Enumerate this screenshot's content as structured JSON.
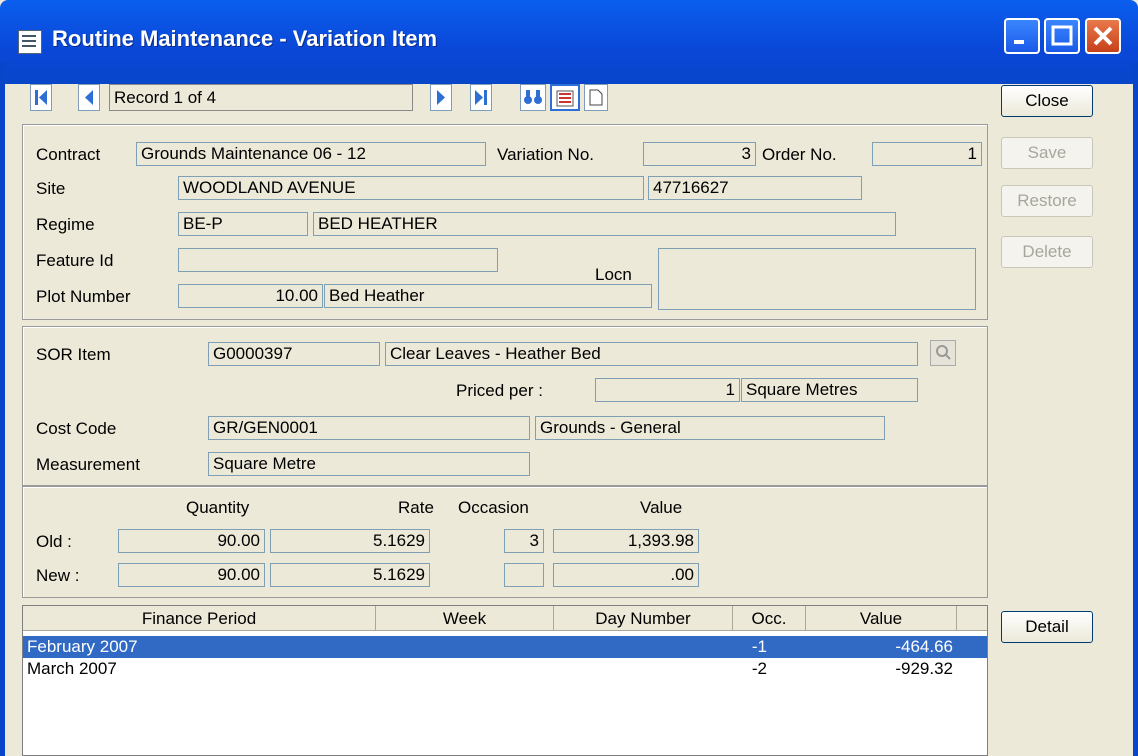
{
  "window": {
    "title": "Routine Maintenance - Variation Item"
  },
  "toolbar": {
    "record": "Record 1 of 4"
  },
  "buttons": {
    "close": "Close",
    "save": "Save",
    "restore": "Restore",
    "delete": "Delete",
    "detail": "Detail"
  },
  "header": {
    "contract_label": "Contract",
    "contract": "Grounds Maintenance 06 - 12",
    "variation_label": "Variation No.",
    "variation_no": "3",
    "order_label": "Order No.",
    "order_no": "1",
    "site_label": "Site",
    "site": "WOODLAND AVENUE",
    "site_ref": "47716627",
    "regime_label": "Regime",
    "regime_code": "BE-P",
    "regime_desc": "BED HEATHER",
    "feature_label": "Feature Id",
    "feature_id": "",
    "locn_label": "Locn",
    "locn": "",
    "plot_label": "Plot Number",
    "plot_number": "10.00",
    "plot_desc": "Bed Heather"
  },
  "sor": {
    "item_label": "SOR Item",
    "item_code": "G0000397",
    "item_desc": "Clear Leaves - Heather Bed",
    "priced_label": "Priced per :",
    "priced_qty": "1",
    "priced_unit": "Square Metres",
    "cost_label": "Cost Code",
    "cost_code": "GR/GEN0001",
    "cost_desc": "Grounds - General",
    "measure_label": "Measurement",
    "measurement": "Square Metre"
  },
  "values": {
    "quantity_label": "Quantity",
    "rate_label": "Rate",
    "occasion_label": "Occasion",
    "value_label": "Value",
    "old_label": "Old :",
    "new_label": "New :",
    "old": {
      "quantity": "90.00",
      "rate": "5.1629",
      "occasion": "3",
      "value": "1,393.98"
    },
    "new": {
      "quantity": "90.00",
      "rate": "5.1629",
      "occasion": "",
      "value": ".00"
    }
  },
  "grid": {
    "columns": [
      "Finance Period",
      "Week",
      "Day Number",
      "Occ.",
      "Value"
    ],
    "rows": [
      {
        "period": "February 2007",
        "week": "",
        "day": "",
        "occ": "-1",
        "value": "-464.66",
        "selected": true
      },
      {
        "period": "March 2007",
        "week": "",
        "day": "",
        "occ": "-2",
        "value": "-929.32",
        "selected": false
      }
    ]
  },
  "colors": {
    "titlebar": "#0a47d8",
    "selection": "#316ac5",
    "window_bg": "#ece9d8"
  },
  "icons": [
    "window-icon",
    "minimize-icon",
    "maximize-icon",
    "close-icon",
    "first-record-icon",
    "previous-record-icon",
    "next-record-icon",
    "last-record-icon",
    "find-icon",
    "list-view-icon",
    "new-record-icon",
    "lookup-icon"
  ]
}
